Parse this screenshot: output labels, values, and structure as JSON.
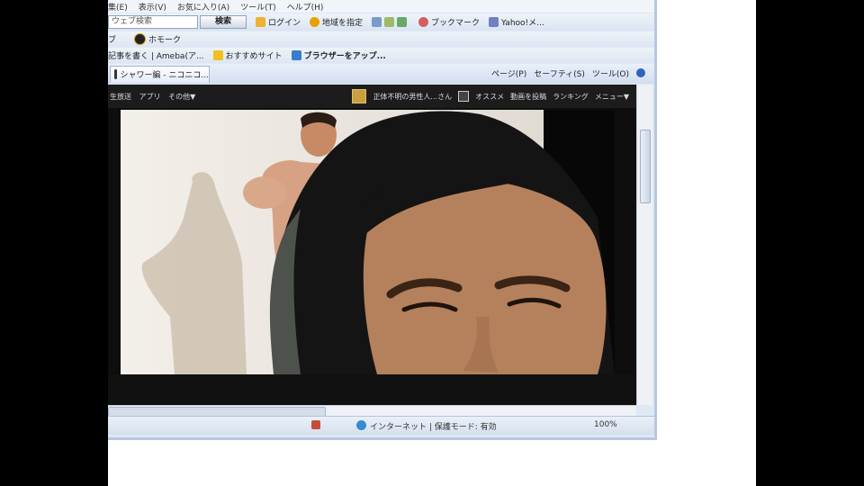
{
  "menu_bar": {
    "items": [
      "集(E)",
      "表示(V)",
      "お気に入り(A)",
      "ツール(T)",
      "ヘルプ(H)"
    ]
  },
  "search_toolbar": {
    "search_placeholder": "ウェブ検索",
    "search_button": "検索",
    "items": [
      "ログイン",
      "地域を指定",
      "ブックマーク",
      "Yahoo!メ..."
    ]
  },
  "toolbar3": {
    "items": [
      "ブ",
      "ホモーク"
    ]
  },
  "favorites_bar": {
    "items": [
      "記事を書く | Ameba(ア...",
      "おすすめサイト",
      "ブラウザーをアップ..."
    ]
  },
  "tab_bar": {
    "active_tab": "シャワー編 - ニコニコ...",
    "command_bar": [
      "ページ(P)",
      "セーフティ(S)",
      "ツール(O)"
    ]
  },
  "nico_nav": {
    "left_items": [
      "生放送",
      "アプリ",
      "その他▼"
    ],
    "user_label": "正体不明の男性人...さん",
    "right_items": [
      "オススメ",
      "動画を投稿",
      "ランキング",
      "メニュー▼"
    ]
  },
  "status_bar": {
    "zone": "インターネット | 保護モード: 有効",
    "zoom": "100%"
  },
  "colors": {
    "ie_chrome": "#dfe8f4",
    "nico_bar": "#1c1c1c",
    "video_bg": "#f0ece6"
  }
}
